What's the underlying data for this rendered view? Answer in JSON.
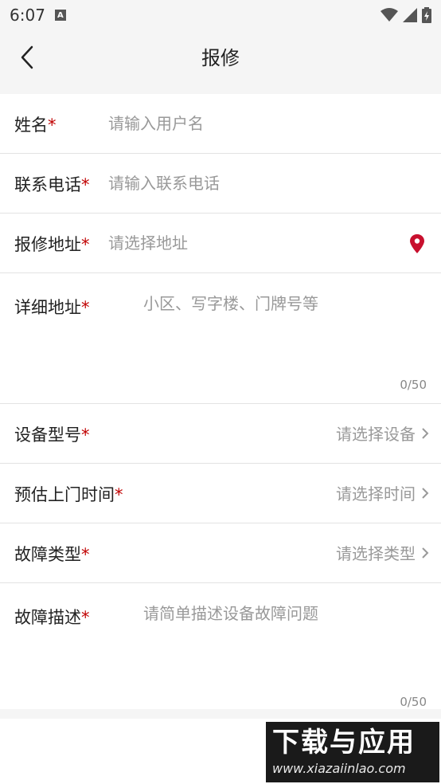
{
  "status_bar": {
    "time": "6:07",
    "notification_icon": "A"
  },
  "header": {
    "title": "报修"
  },
  "form": {
    "name": {
      "label": "姓名",
      "required_mark": "*",
      "placeholder": "请输入用户名"
    },
    "phone": {
      "label": "联系电话",
      "required_mark": "*",
      "placeholder": "请输入联系电话"
    },
    "address": {
      "label": "报修地址",
      "required_mark": "*",
      "placeholder": "请选择地址",
      "icon": "location-pin-icon"
    },
    "detail_address": {
      "label": "详细地址",
      "required_mark": "*",
      "placeholder": "小区、写字楼、门牌号等",
      "counter": "0/50"
    },
    "device_model": {
      "label": "设备型号",
      "required_mark": "*",
      "value": "请选择设备"
    },
    "visit_time": {
      "label": "预估上门时间",
      "required_mark": "*",
      "value": "请选择时间"
    },
    "fault_type": {
      "label": "故障类型",
      "required_mark": "*",
      "value": "请选择类型"
    },
    "fault_description": {
      "label": "故障描述",
      "required_mark": "*",
      "placeholder": "请简单描述设备故障问题",
      "counter": "0/50"
    }
  },
  "watermark": {
    "main": "下载与应用",
    "sub": "www.xiazaiinlao.com"
  },
  "colors": {
    "required": "#c00000",
    "location_icon": "#c8102e",
    "placeholder": "#999999"
  }
}
